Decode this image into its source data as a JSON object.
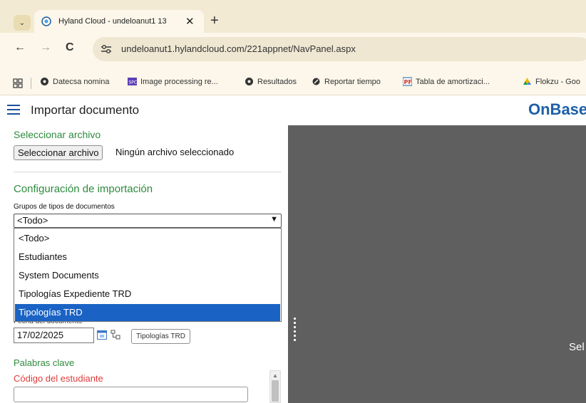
{
  "browser": {
    "tab_title": "Hyland Cloud - undeloanut1 13",
    "new_tab_glyph": "+",
    "close_glyph": "✕",
    "dropdown_glyph": "⌄",
    "url": "undeloanut1.hylandcloud.com/221appnet/NavPanel.aspx",
    "nav": {
      "back": "←",
      "forward": "→",
      "reload": "C"
    },
    "bookmarks": [
      {
        "label": "Datecsa nomina",
        "icon": "globe-icon"
      },
      {
        "label": "Image processing re...",
        "icon": "spc-icon"
      },
      {
        "label": "Resultados",
        "icon": "globe-icon"
      },
      {
        "label": "Reportar tiempo",
        "icon": "pen-icon"
      },
      {
        "label": "Tabla de amortizaci...",
        "icon": "pf-icon"
      },
      {
        "label": "Flokzu - Goo",
        "icon": "drive-icon"
      }
    ]
  },
  "app": {
    "title": "Importar documento",
    "brand": "OnBase"
  },
  "form": {
    "select_file_section": "Seleccionar archivo",
    "select_file_button": "Seleccionar archivo",
    "no_file_text": "Ningún archivo seleccionado",
    "config_section": "Configuración de importación",
    "doc_groups_label": "Grupos de tipos de documentos",
    "doc_groups_value": "<Todo>",
    "doc_groups_options": [
      "<Todo>",
      "Estudiantes",
      "System Documents",
      "Tipologías Expediente TRD",
      "Tipologías TRD"
    ],
    "doc_groups_selected": "Tipologías TRD",
    "date_label": "Fecha del documento",
    "date_value": "17/02/2025",
    "doc_type_button": "Tipologías TRD",
    "keywords_section": "Palabras clave",
    "student_code_label": "Código del estudiante"
  },
  "viewer": {
    "text": "Sel"
  },
  "colors": {
    "accent_green": "#2e8b3d",
    "brand_blue": "#1d5fa8",
    "selected_blue": "#1a63c4",
    "required_red": "#e23b3b",
    "viewer_gray": "#5f5f5f"
  }
}
